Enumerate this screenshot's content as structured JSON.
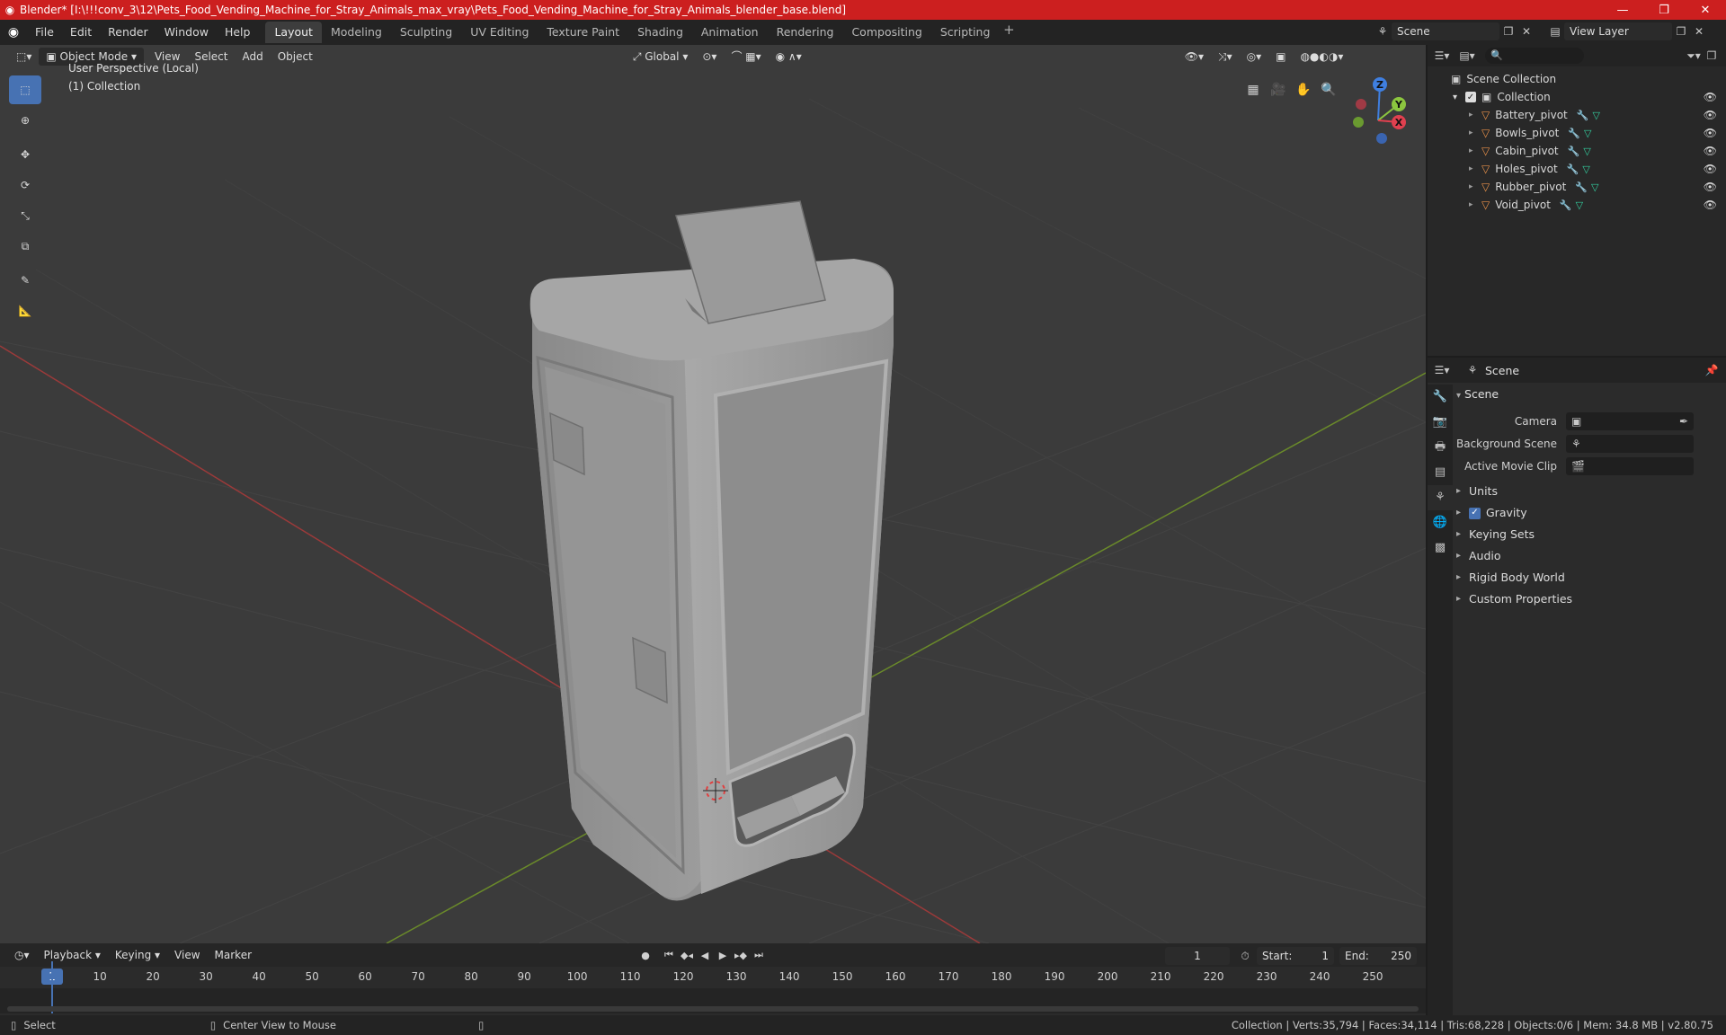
{
  "window": {
    "title": "Blender* [I:\\!!!conv_3\\12\\Pets_Food_Vending_Machine_for_Stray_Animals_max_vray\\Pets_Food_Vending_Machine_for_Stray_Animals_blender_base.blend]",
    "minimize": "—",
    "maximize": "❐",
    "close": "✕"
  },
  "menu": [
    "File",
    "Edit",
    "Render",
    "Window",
    "Help"
  ],
  "workspaces": [
    "Layout",
    "Modeling",
    "Sculpting",
    "UV Editing",
    "Texture Paint",
    "Shading",
    "Animation",
    "Rendering",
    "Compositing",
    "Scripting"
  ],
  "active_workspace": "Layout",
  "scene_name": "Scene",
  "view_layer": "View Layer",
  "viewport": {
    "mode": "Object Mode",
    "menus": [
      "View",
      "Select",
      "Add",
      "Object"
    ],
    "orientation": "Global",
    "perspective_label": "User Perspective (Local)",
    "collection_label": "(1) Collection",
    "gizmo": {
      "x": "X",
      "y": "Y",
      "z": "Z"
    }
  },
  "outliner": {
    "root": "Scene Collection",
    "collection": "Collection",
    "objects": [
      "Battery_pivot",
      "Bowls_pivot",
      "Cabin_pivot",
      "Holes_pivot",
      "Rubber_pivot",
      "Void_pivot"
    ],
    "search_placeholder": ""
  },
  "properties": {
    "context": "Scene",
    "panel": "Scene",
    "rows": [
      {
        "label": "Camera",
        "value": ""
      },
      {
        "label": "Background Scene",
        "value": ""
      },
      {
        "label": "Active Movie Clip",
        "value": ""
      }
    ],
    "subpanels": [
      "Units",
      "Gravity",
      "Keying Sets",
      "Audio",
      "Rigid Body World",
      "Custom Properties"
    ]
  },
  "timeline": {
    "menus": [
      "Playback",
      "Keying",
      "View",
      "Marker"
    ],
    "current_frame": "1",
    "start_label": "Start:",
    "start": "1",
    "end_label": "End:",
    "end": "250",
    "ticks": [
      10,
      20,
      30,
      40,
      50,
      60,
      70,
      80,
      90,
      100,
      110,
      120,
      130,
      140,
      150,
      160,
      170,
      180,
      190,
      200,
      210,
      220,
      230,
      240,
      250
    ]
  },
  "status": {
    "left": "Select",
    "middle": "Center View to Mouse",
    "right": "Collection | Verts:35,794 | Faces:34,114 | Tris:68,228 | Objects:0/6 | Mem: 34.8 MB | v2.80.75"
  },
  "colors": {
    "title_bar": "#cc1f1f",
    "accent": "#4772b3",
    "object_icon": "#e8914a",
    "axis_x": "#e0404f",
    "axis_y": "#8cc63f",
    "axis_z": "#3f7fe0"
  }
}
